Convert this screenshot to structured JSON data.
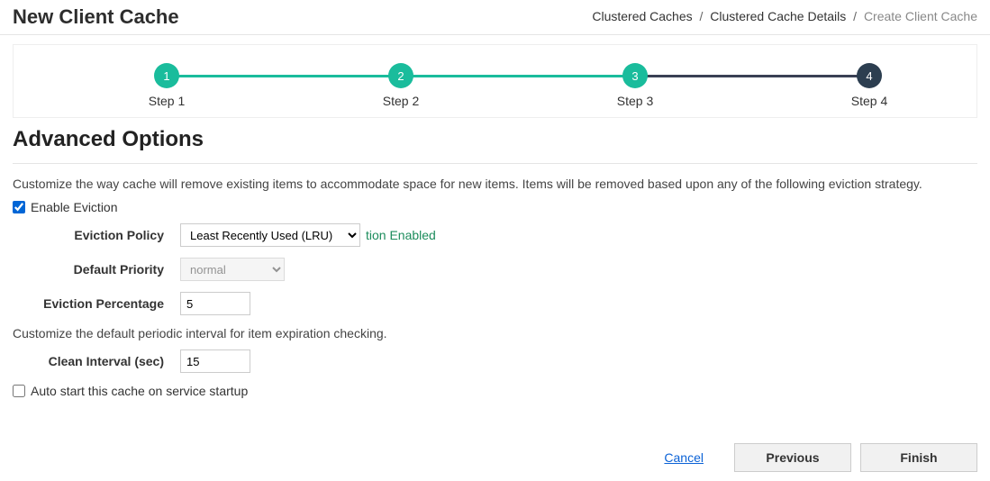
{
  "header": {
    "title": "New Client Cache",
    "breadcrumbs": {
      "a": "Clustered Caches",
      "b": "Clustered Cache Details",
      "c": "Create Client Cache"
    }
  },
  "stepper": {
    "s1": {
      "num": "1",
      "label": "Step 1"
    },
    "s2": {
      "num": "2",
      "label": "Step 2"
    },
    "s3": {
      "num": "3",
      "label": "Step 3"
    },
    "s4": {
      "num": "4",
      "label": "Step 4"
    }
  },
  "section": {
    "title": "Advanced Options",
    "desc1": "Customize the way cache will remove existing items to accommodate space for new items. Items will be removed based upon any of the following eviction strategy.",
    "desc2": "Customize the default periodic interval for item expiration checking."
  },
  "form": {
    "enableEvictionLabel": "Enable Eviction",
    "evictionPolicyLabel": "Eviction Policy",
    "evictionPolicyValue": "Least Recently Used (LRU)",
    "evictionEnabledHint": "tion Enabled",
    "defaultPriorityLabel": "Default Priority",
    "defaultPriorityValue": "normal",
    "evictionPercentageLabel": "Eviction Percentage",
    "evictionPercentageValue": "5",
    "cleanIntervalLabel": "Clean Interval (sec)",
    "cleanIntervalValue": "15",
    "autoStartLabel": "Auto start this cache on service startup"
  },
  "actions": {
    "cancel": "Cancel",
    "previous": "Previous",
    "finish": "Finish"
  }
}
